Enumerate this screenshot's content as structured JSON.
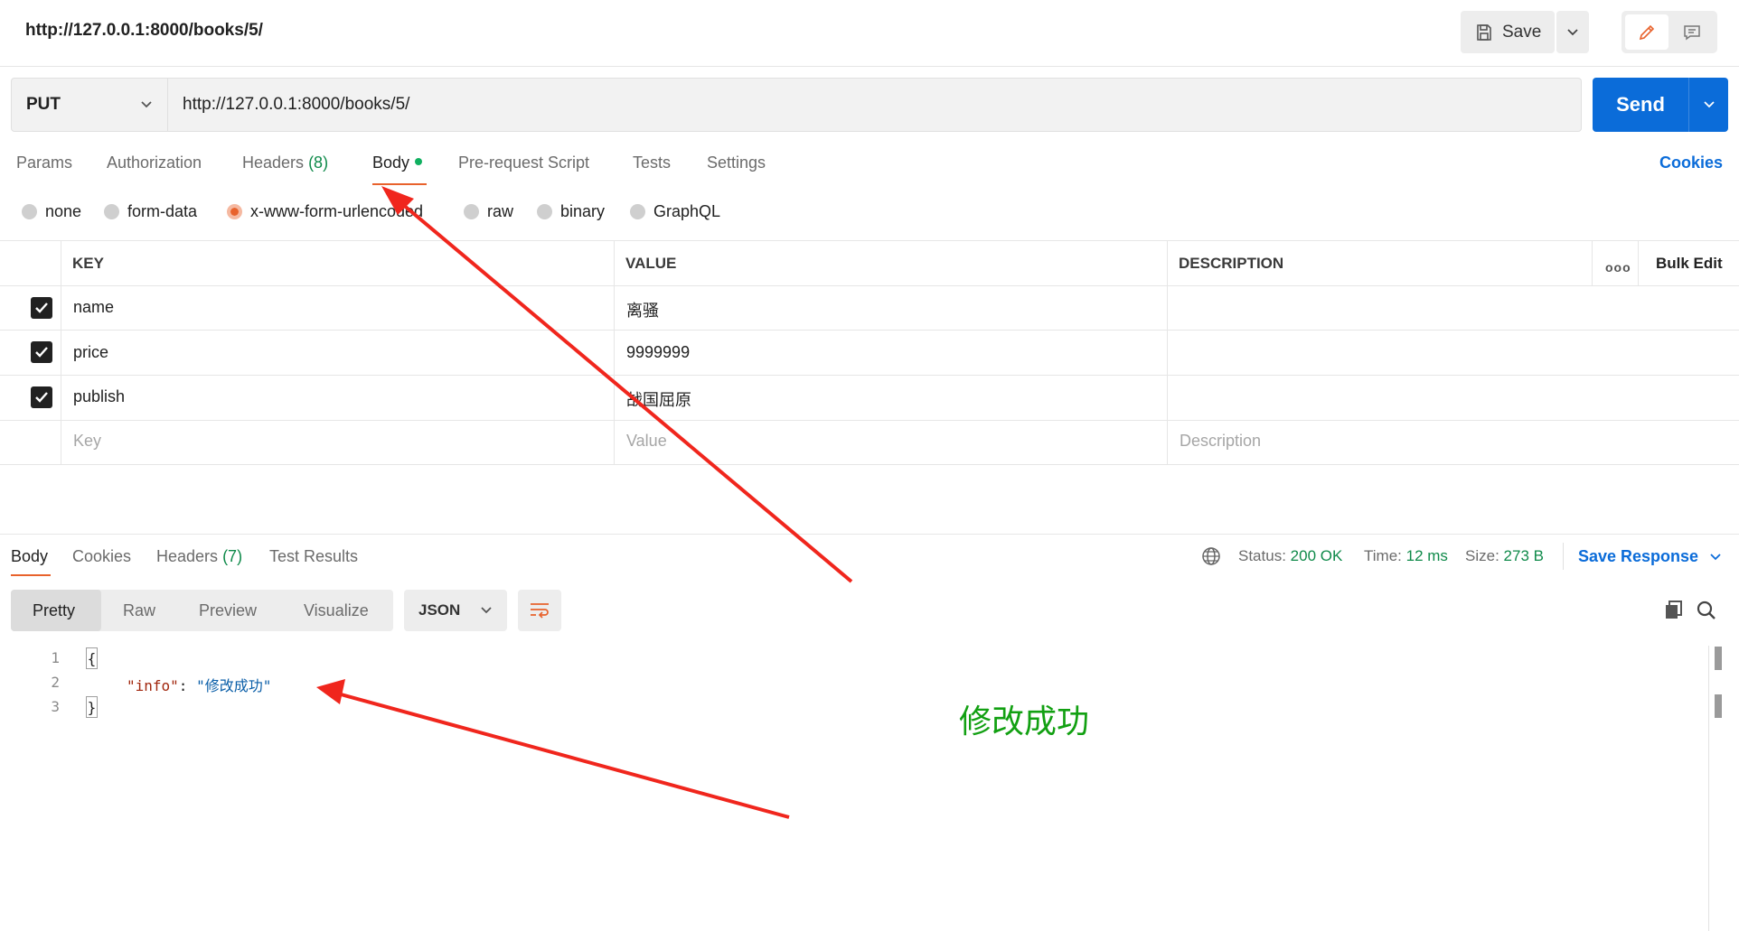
{
  "window": {
    "title_url": "http://127.0.0.1:8000/books/5/",
    "save_label": "Save"
  },
  "request": {
    "method": "PUT",
    "url": "http://127.0.0.1:8000/books/5/",
    "send_label": "Send"
  },
  "request_tabs": [
    {
      "label": "Params"
    },
    {
      "label": "Authorization"
    },
    {
      "label": "Headers",
      "count": "(8)"
    },
    {
      "label": "Body",
      "active": true
    },
    {
      "label": "Pre-request Script"
    },
    {
      "label": "Tests"
    },
    {
      "label": "Settings"
    }
  ],
  "cookies_label": "Cookies",
  "body_types": [
    {
      "label": "none"
    },
    {
      "label": "form-data"
    },
    {
      "label": "x-www-form-urlencoded",
      "selected": true
    },
    {
      "label": "raw"
    },
    {
      "label": "binary"
    },
    {
      "label": "GraphQL"
    }
  ],
  "params_table": {
    "headers": {
      "key": "KEY",
      "value": "VALUE",
      "description": "DESCRIPTION",
      "bulk_edit": "Bulk Edit",
      "more": "ooo"
    },
    "rows": [
      {
        "key": "name",
        "value": "离骚",
        "checked": true
      },
      {
        "key": "price",
        "value": "9999999",
        "checked": true
      },
      {
        "key": "publish",
        "value": "战国屈原",
        "checked": true
      }
    ],
    "placeholders": {
      "key": "Key",
      "value": "Value",
      "description": "Description"
    }
  },
  "response": {
    "tabs": [
      {
        "label": "Body",
        "active": true
      },
      {
        "label": "Cookies"
      },
      {
        "label": "Headers",
        "count": "(7)"
      },
      {
        "label": "Test Results"
      }
    ],
    "status_label": "Status:",
    "status_value": "200 OK",
    "time_label": "Time:",
    "time_value": "12 ms",
    "size_label": "Size:",
    "size_value": "273 B",
    "save_response_label": "Save Response",
    "formats": [
      {
        "label": "Pretty",
        "active": true
      },
      {
        "label": "Raw"
      },
      {
        "label": "Preview"
      },
      {
        "label": "Visualize"
      }
    ],
    "language": "JSON",
    "code_lines": [
      {
        "num": "1",
        "text": "{"
      },
      {
        "num": "2",
        "key": "\"info\"",
        "sep": ": ",
        "value": "\"修改成功\""
      },
      {
        "num": "3",
        "text": "}"
      }
    ]
  },
  "annotation_text": "修改成功",
  "colors": {
    "accent": "#e8622c",
    "send_blue": "#0b6cd9",
    "ok_green": "#0f8a4a",
    "annotation_green": "#12a012",
    "arrow_red": "#f0261d"
  },
  "icons": [
    "save-icon",
    "chevron-down-icon",
    "pencil-icon",
    "comment-icon",
    "checkbox-checked-icon",
    "globe-icon",
    "wrap-lines-icon",
    "copy-icon",
    "search-icon"
  ]
}
